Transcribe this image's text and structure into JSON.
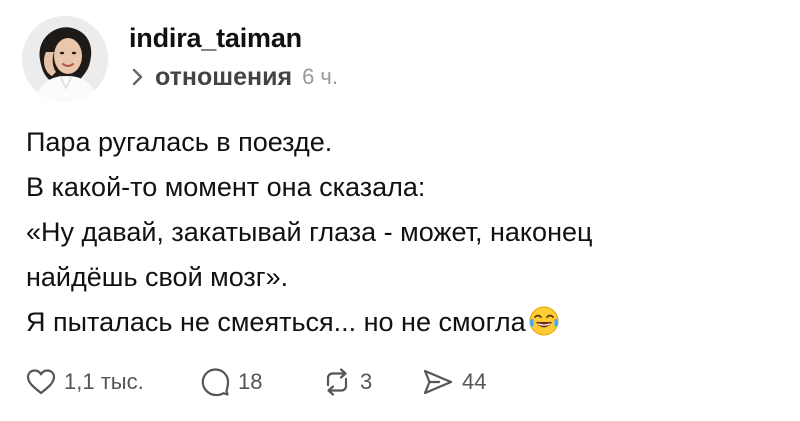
{
  "post": {
    "username": "indira_taiman",
    "topic": "отношения",
    "time": "6 ч.",
    "lines": [
      "Пара ругалась в поезде.",
      "В какой-то момент она сказала:",
      "«Ну давай, закатывай глаза - может, наконец",
      "найдёшь свой мозг».",
      "Я пыталась не смеяться... но не смогла"
    ],
    "emoji": "face-with-tears-of-joy-icon"
  },
  "actions": {
    "likes": "1,1 тыс.",
    "replies": "18",
    "reposts": "3",
    "shares": "44"
  },
  "icons": {
    "like": "heart-icon",
    "reply": "speech-bubble-icon",
    "repost": "repost-arrows-icon",
    "share": "send-arrow-icon",
    "topic": "chevron-right-icon"
  },
  "colors": {
    "text": "#111111",
    "secondary": "#555555",
    "muted": "#9a9a9a"
  }
}
